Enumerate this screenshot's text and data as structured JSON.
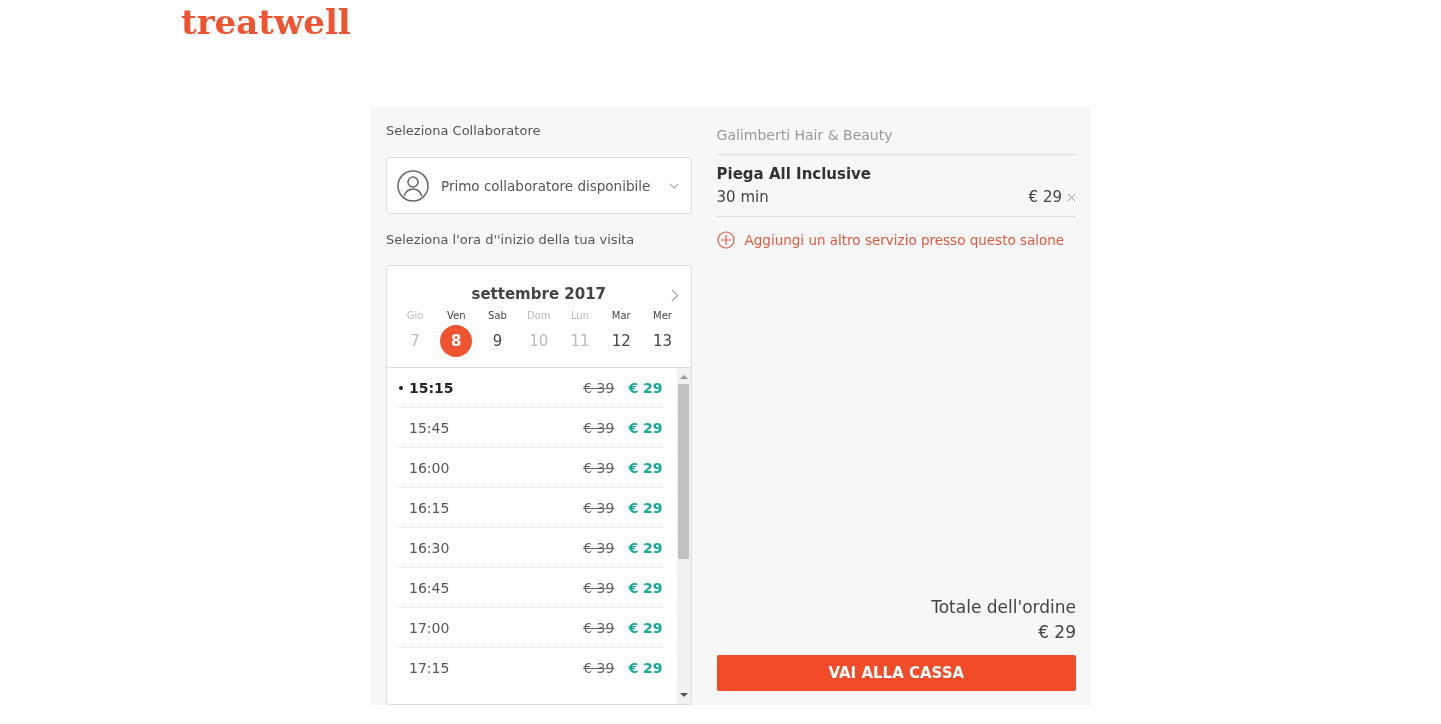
{
  "logo": "treatwell",
  "staff": {
    "label": "Seleziona Collaboratore",
    "value": "Primo collaboratore disponibile"
  },
  "time_label": "Seleziona l'ora d''inizio della tua visita",
  "calendar": {
    "month": "settembre 2017",
    "days": [
      {
        "weekday": "Gio",
        "date": "7",
        "disabled": true,
        "selected": false
      },
      {
        "weekday": "Ven",
        "date": "8",
        "disabled": false,
        "selected": true
      },
      {
        "weekday": "Sab",
        "date": "9",
        "disabled": false,
        "selected": false
      },
      {
        "weekday": "Dom",
        "date": "10",
        "disabled": true,
        "selected": false
      },
      {
        "weekday": "Lun",
        "date": "11",
        "disabled": true,
        "selected": false
      },
      {
        "weekday": "Mar",
        "date": "12",
        "disabled": false,
        "selected": false
      },
      {
        "weekday": "Mer",
        "date": "13",
        "disabled": false,
        "selected": false
      }
    ]
  },
  "slots": [
    {
      "time": "15:15",
      "old_price": "€ 39",
      "price": "€ 29",
      "selected": true
    },
    {
      "time": "15:45",
      "old_price": "€ 39",
      "price": "€ 29",
      "selected": false
    },
    {
      "time": "16:00",
      "old_price": "€ 39",
      "price": "€ 29",
      "selected": false
    },
    {
      "time": "16:15",
      "old_price": "€ 39",
      "price": "€ 29",
      "selected": false
    },
    {
      "time": "16:30",
      "old_price": "€ 39",
      "price": "€ 29",
      "selected": false
    },
    {
      "time": "16:45",
      "old_price": "€ 39",
      "price": "€ 29",
      "selected": false
    },
    {
      "time": "17:00",
      "old_price": "€ 39",
      "price": "€ 29",
      "selected": false
    },
    {
      "time": "17:15",
      "old_price": "€ 39",
      "price": "€ 29",
      "selected": false
    }
  ],
  "salon": "Galimberti Hair & Beauty",
  "service": {
    "name": "Piega All Inclusive",
    "duration": "30 min",
    "price": "€ 29"
  },
  "add_service": "Aggiungi un altro servizio presso questo salone",
  "total": {
    "label": "Totale dell'ordine",
    "amount": "€ 29"
  },
  "checkout_button": "VAI ALLA CASSA"
}
